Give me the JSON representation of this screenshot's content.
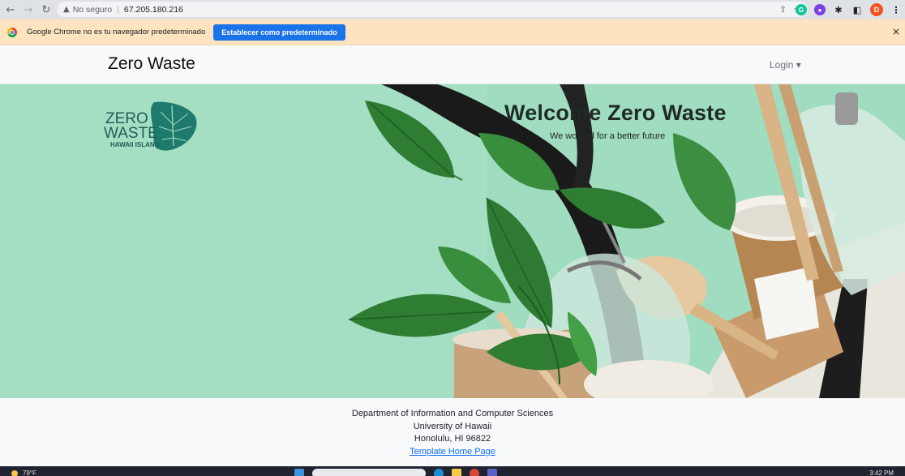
{
  "browser": {
    "back_icon": "arrow-left",
    "forward_icon": "arrow-right",
    "reload_icon": "reload",
    "security_label": "No seguro",
    "url": "67.205.180.216",
    "profile_initial": "D"
  },
  "infobar": {
    "message": "Google Chrome no es tu navegador predeterminado",
    "button_label": "Establecer como predeterminado",
    "close_label": "×"
  },
  "navbar": {
    "brand": "Zero Waste",
    "login_label": "Login ▾"
  },
  "hero": {
    "logo_text_1": "ZERO",
    "logo_text_2": "WASTE",
    "logo_text_3": "HAWAII ISLAND",
    "title": "Welcome Zero Waste",
    "subtitle": "We worked for a better future"
  },
  "footer": {
    "line1": "Department of Information and Computer Sciences",
    "line2": "University of Hawaii",
    "line3": "Honolulu, HI 96822",
    "link_label": "Template Home Page"
  },
  "taskbar": {
    "weather": "79°F",
    "clock": "3:42 PM"
  },
  "colors": {
    "hero_bg": "#9fdcc0",
    "leaf": "#2e7d32",
    "chrome_blue": "#1a73e8",
    "infobar_bg": "#fde3c0"
  }
}
